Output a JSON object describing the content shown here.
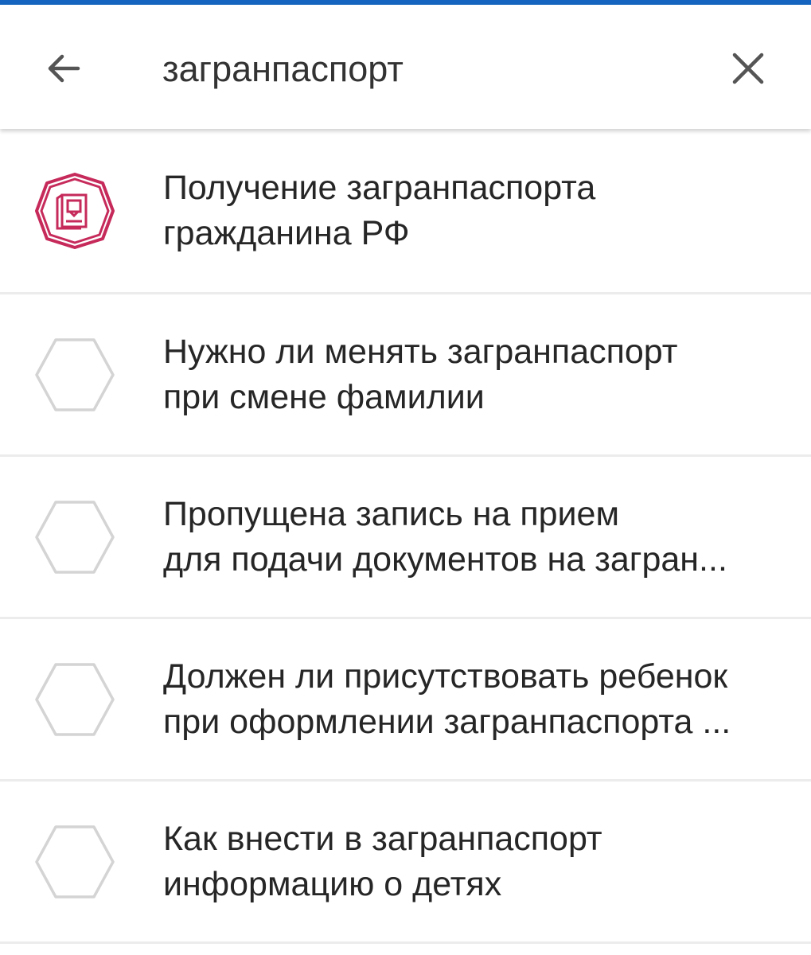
{
  "search": {
    "query": "загранпаспорт"
  },
  "accent_color": "#1565c0",
  "brand_icon_color": "#c62a5b",
  "results": [
    {
      "title": "Получение загранпаспорта\nгражданина РФ",
      "icon": "passport-icon"
    },
    {
      "title": "Нужно ли менять загранпаспорт\nпри смене фамилии",
      "icon": "hexagon-outline-icon"
    },
    {
      "title": "Пропущена запись на прием\nдля подачи документов на загран...",
      "icon": "hexagon-outline-icon"
    },
    {
      "title": "Должен ли присутствовать ребенок\nпри оформлении загранпаспорта ...",
      "icon": "hexagon-outline-icon"
    },
    {
      "title": "Как внести в загранпаспорт\nинформацию о детях",
      "icon": "hexagon-outline-icon"
    }
  ]
}
